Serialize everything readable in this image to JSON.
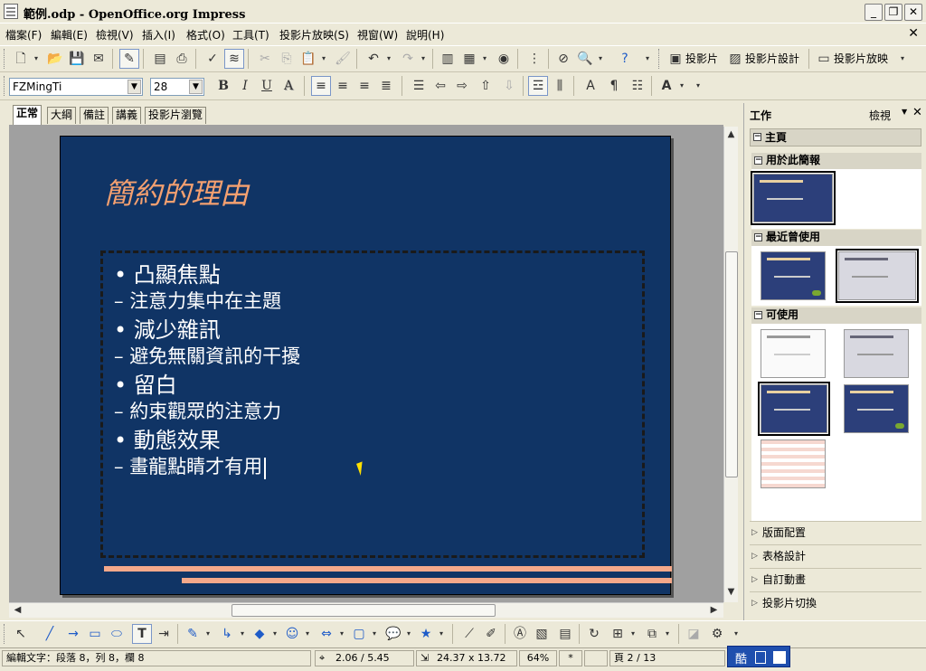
{
  "window": {
    "title": "範例.odp - OpenOffice.org Impress",
    "controls": {
      "minimize": "_",
      "restore": "❐",
      "close": "✕"
    }
  },
  "menu": {
    "items": [
      "檔案(F)",
      "編輯(E)",
      "檢視(V)",
      "插入(I)",
      "格式(O)",
      "工具(T)",
      "投影片放映(S)",
      "視窗(W)",
      "說明(H)"
    ],
    "close": "✕"
  },
  "toolbar_standard": {
    "slide_label": "投影片",
    "slide_design_label": "投影片設計",
    "slideshow_label": "投影片放映"
  },
  "toolbar_format": {
    "font_name": "FZMingTi",
    "font_size": "28",
    "bold": "B",
    "italic": "I",
    "underline": "U",
    "shadow": "A",
    "font_color": "A"
  },
  "view_tabs": [
    "正常",
    "大綱",
    "備註",
    "講義",
    "投影片瀏覽"
  ],
  "slide": {
    "title": "簡約的理由",
    "bullets": [
      {
        "level": 1,
        "text": "凸顯焦點"
      },
      {
        "level": 2,
        "text": "注意力集中在主題"
      },
      {
        "level": 1,
        "text": "減少雜訊"
      },
      {
        "level": 2,
        "text": "避免無關資訊的干擾"
      },
      {
        "level": 1,
        "text": "留白"
      },
      {
        "level": 2,
        "text": "約束觀眾的注意力"
      },
      {
        "level": 1,
        "text": "動態效果"
      },
      {
        "level": 2,
        "text": "畫龍點睛才有用"
      }
    ],
    "bullet1_symbol": "•",
    "bullet2_symbol": "–",
    "colors": {
      "background": "#103465",
      "title": "#f4a070",
      "text": "#ffffff",
      "bars": "#f4a88a"
    }
  },
  "task_pane": {
    "title": "工作",
    "view_label": "檢視",
    "close": "✕",
    "master_section": "主頁",
    "sub_used": "用於此簡報",
    "sub_recent": "最近曾使用",
    "sub_available": "可使用",
    "collapsed": [
      "版面配置",
      "表格設計",
      "自訂動畫",
      "投影片切換"
    ]
  },
  "status": {
    "edit_text": "編輯文字：段落 8，列 8，欄 8",
    "position": "2.06 / 5.45",
    "size": "24.37 x 13.72",
    "zoom": "64%",
    "modified": "*",
    "page": "頁 2 / 13"
  },
  "ime": {
    "mode": "酷"
  }
}
